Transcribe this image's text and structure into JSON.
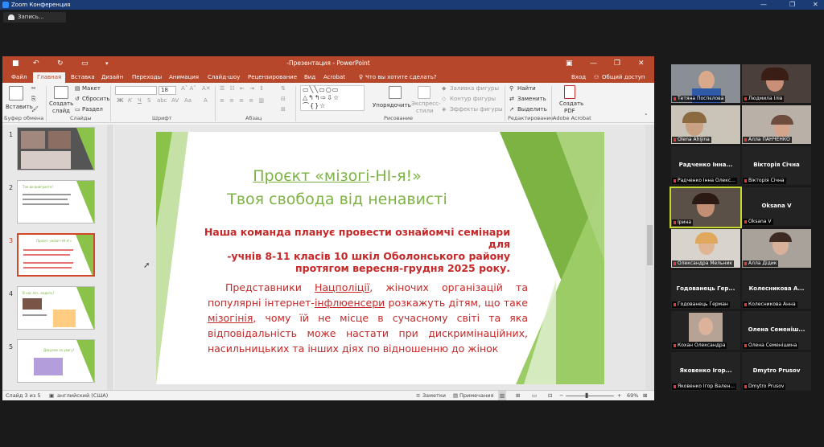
{
  "zoom": {
    "title": "Zoom Конференция",
    "record_label": "Запись..."
  },
  "ppt": {
    "title": "-Презентация - PowerPoint",
    "tabs": [
      "Файл",
      "Главная",
      "Вставка",
      "Дизайн",
      "Переходы",
      "Анимация",
      "Слайд-шоу",
      "Рецензирование",
      "Вид",
      "Acrobat"
    ],
    "tell_me": "Что вы хотите сделать?",
    "login": "Вход",
    "share": "Общий доступ",
    "ribbon": {
      "paste": "Вставить",
      "create": "Создать",
      "slide": "слайд",
      "layout": "Макет",
      "reset": "Сбросить",
      "section": "Раздел",
      "font_size": "18",
      "arrange": "Упорядочить",
      "quick_styles": "Экспресс-",
      "styles": "стили",
      "fill": "Заливка фигуры",
      "outline": "Контур фигуры",
      "effects": "Эффекты фигуры",
      "find": "Найти",
      "replace": "Заменить",
      "select": "Выделить",
      "create_pdf": "Создать",
      "pdf": "PDF",
      "groups": {
        "clipboard": "Буфер обмена",
        "slides": "Слайды",
        "font": "Шрифт",
        "paragraph": "Абзац",
        "drawing": "Рисование",
        "editing": "Редактирование",
        "acrobat": "Adobe Acrobat"
      }
    },
    "thumbs": [
      {
        "num": "1",
        "title": ""
      },
      {
        "num": "2",
        "title": "Так ви вийграєте!"
      },
      {
        "num": "3",
        "title": "Проєкт «мізогі-НІ-я!»"
      },
      {
        "num": "4",
        "title": "В нас ліп...ходить!"
      },
      {
        "num": "5",
        "title": "Дякуємо за увагу!"
      }
    ],
    "slide": {
      "title_a": "Проєкт «",
      "title_b": "мізогі",
      "title_c": "-НІ-я!»",
      "subtitle": "Твоя свобода від ненависті",
      "p1_line1": "Наша команда планує провести ознайомчі семінари для",
      "p1_line2": "-учнів 8-11 класів 10 шкіл Оболонського району",
      "p1_line3": "протягом вересня-грудня 2025 року.",
      "p2_a": "Представники ",
      "p2_b": "Нацполіції",
      "p2_c": ", жіночих організацій та популярні інтернет-",
      "p2_d": "інфлюенсери",
      "p2_e": " розкажуть дітям, що таке ",
      "p2_f": "мізогінія",
      "p2_g": ", чому їй не місце в сучасному світі та яка відповідальність може настати при дискримінаційних, насильницьких та інших діях по відношенню до жінок"
    },
    "status": {
      "slide_info": "Слайд 3 из 5",
      "language": "английский (США)",
      "notes": "Заметки",
      "comments": "Примечания",
      "zoom": "69%"
    }
  },
  "participants": [
    {
      "name": "Тетяна Поспєлова",
      "big": ""
    },
    {
      "name": "Людмила Ілів",
      "big": ""
    },
    {
      "name": "Olena Ahijina",
      "big": ""
    },
    {
      "name": "Алла ПАНЧЕНКО",
      "big": ""
    },
    {
      "name": "Радченко Інна Олекс...",
      "big": "Радченко Інна..."
    },
    {
      "name": "Вікторія Січна",
      "big": "Вікторія Січна"
    },
    {
      "name": "Ірина",
      "big": ""
    },
    {
      "name": "Oksana V",
      "big": "Oksana V"
    },
    {
      "name": "Олександра Мельник",
      "big": ""
    },
    {
      "name": "Алла Дідик",
      "big": ""
    },
    {
      "name": "Годованець Герман",
      "big": "Годованець Гер..."
    },
    {
      "name": "Колесникова Анна",
      "big": "Колесникова А..."
    },
    {
      "name": "Кохан Олександра",
      "big": ""
    },
    {
      "name": "Олена Семенішина",
      "big": "Олена Семеніш..."
    },
    {
      "name": "Яковенко Ігор Вален...",
      "big": "Яковенко Ігор..."
    },
    {
      "name": "Dmytro Prusov",
      "big": "Dmytro Prusov"
    }
  ]
}
